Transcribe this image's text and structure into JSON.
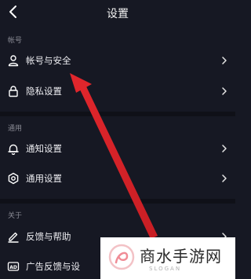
{
  "header": {
    "title": "设置",
    "back_icon": "chevron-left-icon"
  },
  "sections": [
    {
      "label": "帐号",
      "items": [
        {
          "label": "帐号与安全",
          "icon": "user-icon"
        },
        {
          "label": "隐私设置",
          "icon": "lock-icon"
        }
      ]
    },
    {
      "label": "通用",
      "items": [
        {
          "label": "通知设置",
          "icon": "bell-icon"
        },
        {
          "label": "通用设置",
          "icon": "gear-icon"
        }
      ]
    },
    {
      "label": "关于",
      "items": [
        {
          "label": "反馈与帮助",
          "icon": "pen-icon"
        },
        {
          "label": "广告反馈与设",
          "icon": "ad-icon"
        }
      ]
    }
  ],
  "watermark": {
    "text": "商水手游网",
    "sub": "SLOGAN"
  },
  "colors": {
    "background": "#161823",
    "text": "#ffffff",
    "secondary": "#8a8b95",
    "annotation_arrow": "#e0262c"
  }
}
